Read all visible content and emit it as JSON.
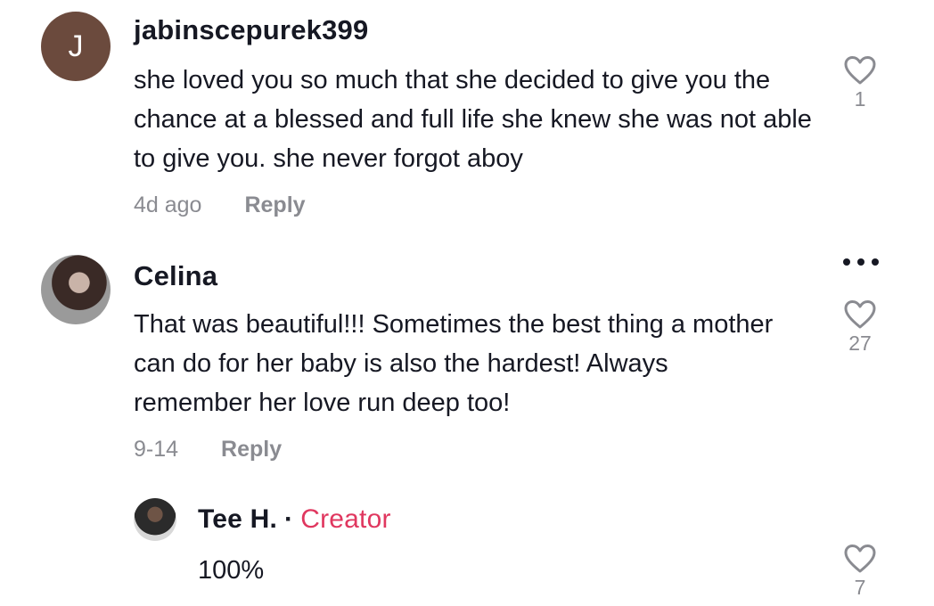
{
  "comments": [
    {
      "avatar_letter": "J",
      "username": "jabinscepurek399",
      "text": "she loved you so much that she decided to give you the chance at a blessed and full life she knew she was not able to give you. she never forgot aboy",
      "time": "4d ago",
      "reply_label": "Reply",
      "likes": "1"
    },
    {
      "username": "Celina",
      "text": "That was beautiful!!! Sometimes the best thing a mother can do for her baby is also the hardest! Always remember her love run deep too!",
      "time": "9-14",
      "reply_label": "Reply",
      "likes": "27"
    }
  ],
  "reply": {
    "username": "Tee H.",
    "separator": "·",
    "creator_label": "Creator",
    "text": "100%",
    "likes": "7"
  },
  "colors": {
    "creator": "#e0375f",
    "muted": "#8a8b91",
    "text": "#161823"
  }
}
